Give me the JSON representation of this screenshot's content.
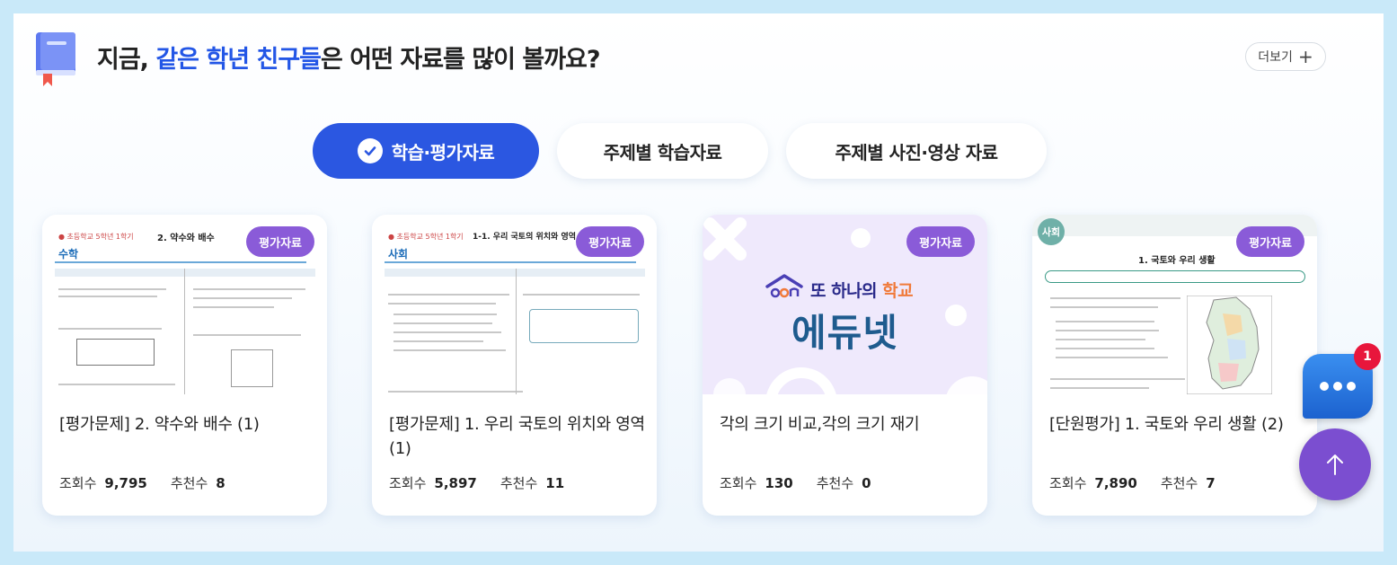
{
  "header": {
    "title_prefix": "지금, ",
    "title_highlight": "같은 학년 친구들",
    "title_suffix": "은 어떤 자료를 많이 볼까요?",
    "more_label": "더보기",
    "icon": "book-bookmark-icon"
  },
  "tabs": [
    {
      "label": "학습·평가자료",
      "active": true
    },
    {
      "label": "주제별 학습자료",
      "active": false
    },
    {
      "label": "주제별 사진·영상 자료",
      "active": false
    }
  ],
  "cards": [
    {
      "badge": "평가자료",
      "title": "[평가문제] 2. 약수와 배수 (1)",
      "views_label": "조회수",
      "views": "9,795",
      "likes_label": "추천수",
      "likes": "8",
      "thumb": {
        "subject": "수학",
        "unit": "2. 약수와 배수"
      }
    },
    {
      "badge": "평가자료",
      "title": "[평가문제] 1. 우리 국토의 위치와 영역(1)",
      "views_label": "조회수",
      "views": "5,897",
      "likes_label": "추천수",
      "likes": "11",
      "thumb": {
        "subject": "사회",
        "unit": "1-1. 우리 국토의 위치와 영역"
      }
    },
    {
      "badge": "평가자료",
      "title": "각의 크기 비교,각의 크기 재기",
      "views_label": "조회수",
      "views": "130",
      "likes_label": "추천수",
      "likes": "0",
      "thumb": {
        "tagline_a": "또 하나의 ",
        "tagline_b": "학교",
        "brand": "에듀넷"
      }
    },
    {
      "badge": "평가자료",
      "title": "[단원평가] 1. 국토와 우리 생활 (2)",
      "views_label": "조회수",
      "views": "7,890",
      "likes_label": "추천수",
      "likes": "7",
      "thumb": {
        "subject": "사회",
        "unit": "1. 국토와 우리 생활"
      }
    }
  ],
  "floating": {
    "chat_badge": "1",
    "chat_icon": "chat-bubble-icon",
    "top_icon": "arrow-up-icon"
  },
  "colors": {
    "accent": "#2b57e1",
    "highlight_text": "#2356e6",
    "badge": "#8a5bd8",
    "top_button": "#7b4ed0",
    "chat_badge": "#e8163c",
    "background": "#c9e9f9"
  }
}
